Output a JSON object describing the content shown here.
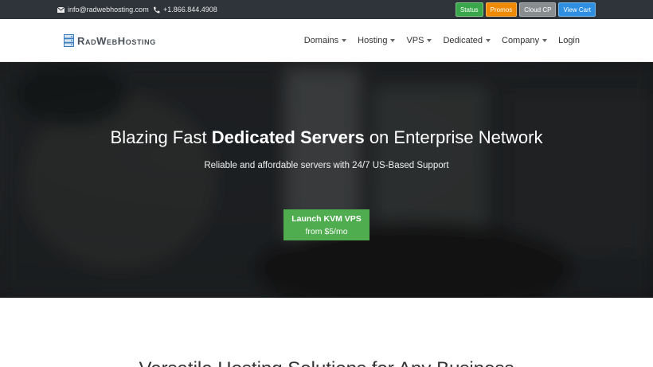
{
  "topbar": {
    "email": "info@radwebhosting.com",
    "phone": "+1.866.844.4908",
    "buttons": [
      {
        "label": "Status",
        "color": "#3aa84a"
      },
      {
        "label": "Promos",
        "color": "#f08a00"
      },
      {
        "label": "Cloud CP",
        "color": "#8a8d90"
      },
      {
        "label": "View Cart",
        "color": "#2f8fe0"
      }
    ]
  },
  "nav": {
    "logo": "RadWebHosting",
    "items": [
      {
        "label": "Domains"
      },
      {
        "label": "Hosting"
      },
      {
        "label": "VPS"
      },
      {
        "label": "Dedicated"
      },
      {
        "label": "Company"
      },
      {
        "label": "Login"
      }
    ]
  },
  "hero": {
    "title_pre": "Blazing Fast ",
    "title_bold": "Dedicated Servers",
    "title_post": " on Enterprise Network",
    "subtitle": "Reliable and affordable servers with 24/7 US-Based Support",
    "cta_line1": "Launch KVM VPS",
    "cta_line2": "from $5/mo"
  },
  "section": {
    "title": "Versatile Hosting Solutions for Any Business"
  }
}
